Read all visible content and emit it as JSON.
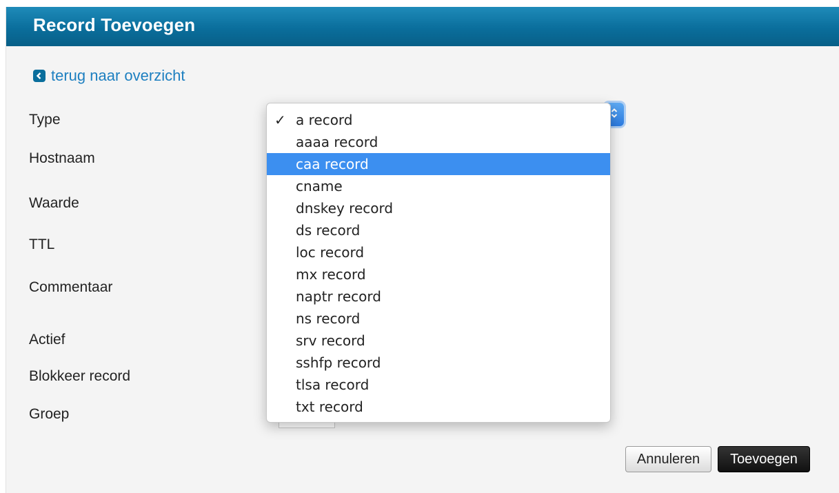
{
  "dialog": {
    "title": "Record Toevoegen"
  },
  "back_link": {
    "label": "terug naar overzicht",
    "icon": "arrow-left-icon"
  },
  "form": {
    "labels": {
      "type": "Type",
      "hostname": "Hostnaam",
      "value": "Waarde",
      "ttl": "TTL",
      "comment": "Commentaar",
      "active": "Actief",
      "block": "Blokkeer record",
      "group": "Groep"
    }
  },
  "type_select": {
    "selected": "a record",
    "highlighted": "caa record",
    "options": [
      "a record",
      "aaaa record",
      "caa record",
      "cname",
      "dnskey record",
      "ds record",
      "loc record",
      "mx record",
      "naptr record",
      "ns record",
      "srv record",
      "sshfp record",
      "tlsa record",
      "txt record"
    ],
    "check_mark": "✓"
  },
  "buttons": {
    "cancel": "Annuleren",
    "add": "Toevoegen"
  },
  "colors": {
    "header": "#0a6e9c",
    "link": "#1d7fc0",
    "highlight": "#3c8ff0",
    "primary_button": "#1a1a1a"
  }
}
